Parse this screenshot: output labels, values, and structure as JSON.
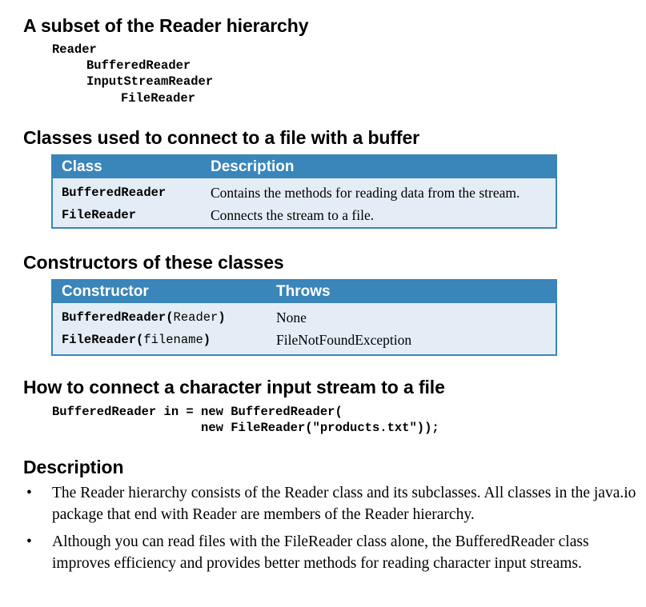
{
  "hierarchy": {
    "heading": "A subset of the Reader hierarchy",
    "lines": [
      {
        "indent": 0,
        "text": "Reader"
      },
      {
        "indent": 1,
        "text": "BufferedReader"
      },
      {
        "indent": 1,
        "text": "InputStreamReader"
      },
      {
        "indent": 2,
        "text": "FileReader"
      }
    ]
  },
  "classes_section": {
    "heading": "Classes used to connect to a file with a buffer",
    "col1_header": "Class",
    "col2_header": "Description",
    "rows": [
      {
        "name": "BufferedReader",
        "description": "Contains the methods for reading data from the stream."
      },
      {
        "name": "FileReader",
        "description": "Connects the stream to a file."
      }
    ]
  },
  "constructors_section": {
    "heading": "Constructors of these classes",
    "col1_header": "Constructor",
    "col2_header": "Throws",
    "rows": [
      {
        "name": "BufferedReader",
        "open": "(",
        "arg": "Reader",
        "close": ")",
        "throws": "None"
      },
      {
        "name": "FileReader",
        "open": "(",
        "arg": "filename",
        "close": ")",
        "throws": "FileNotFoundException"
      }
    ]
  },
  "example_section": {
    "heading": "How to connect a character input stream to a file",
    "code_lines": [
      "BufferedReader in = new BufferedReader(",
      "                    new FileReader(\"products.txt\"));"
    ]
  },
  "description_section": {
    "heading": "Description",
    "bullet_symbol": "•",
    "bullets": [
      "The Reader hierarchy consists of the Reader class and its subclasses. All classes in the java.io package that end with Reader are members of the Reader hierarchy.",
      "Although you can read files with the FileReader class alone, the BufferedReader class improves efficiency and provides better methods for reading character input streams."
    ]
  },
  "colors": {
    "table_header": "#3a85b9",
    "table_body": "#e4edf6"
  }
}
